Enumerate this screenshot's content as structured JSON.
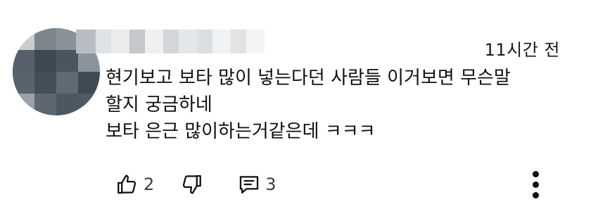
{
  "comment": {
    "timestamp": "11시간 전",
    "lines": [
      "현기보고 보타 많이 넣는다던 사람들 이거보면 무슨말",
      "할지 궁금하네",
      "보타 은근 많이하는거같은데 ㅋㅋㅋ"
    ]
  },
  "actions": {
    "like_count": "2",
    "reply_count": "3"
  },
  "icons": {
    "like": "thumbs-up-icon",
    "dislike": "thumbs-down-icon",
    "reply": "comment-icon",
    "more": "more-vertical-icon"
  },
  "colors": {
    "text": "#0f0f0f",
    "secondary": "#3b3b3b",
    "avatar": "#6f7780"
  }
}
